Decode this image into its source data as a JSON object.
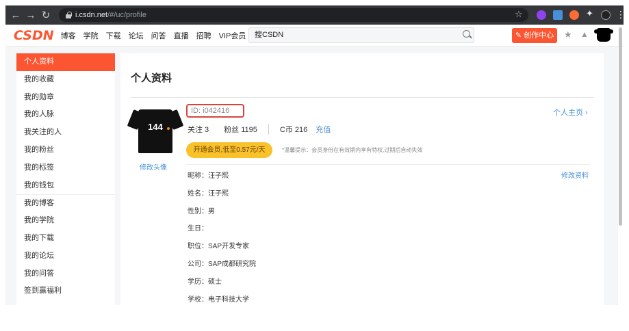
{
  "browser": {
    "url_host": "i.csdn.net",
    "url_path": "/#/uc/profile"
  },
  "header": {
    "logo": "CSDN",
    "nav": [
      "博客",
      "学院",
      "下载",
      "论坛",
      "问答",
      "直播",
      "招聘",
      "VIP会员"
    ],
    "search_placeholder": "搜CSDN",
    "create_button": "创作中心"
  },
  "sidebar": {
    "items": [
      {
        "label": "个人资料",
        "active": true
      },
      {
        "label": "我的收藏"
      },
      {
        "label": "我的勋章"
      },
      {
        "label": "我的人脉"
      },
      {
        "label": "我关注的人"
      },
      {
        "label": "我的粉丝"
      },
      {
        "label": "我的标签"
      },
      {
        "label": "我的钱包"
      },
      {
        "label": "我的博客"
      },
      {
        "label": "我的学院"
      },
      {
        "label": "我的下载"
      },
      {
        "label": "我的论坛"
      },
      {
        "label": "我的问答"
      },
      {
        "label": "签到赢福利"
      }
    ]
  },
  "profile": {
    "title": "个人资料",
    "id_text": "ID: i042416",
    "home_link": "个人主页",
    "edit_avatar": "修改头像",
    "avatar_number": "144",
    "stats": {
      "following": "关注 3",
      "followers": "粉丝 1195",
      "credit": "C币 216",
      "credit_link": "充值"
    },
    "vip_button": "开通会员,低至0.57元/天",
    "vip_note": "*温馨提示：会员身份在有效期内享有特权,过期后自动失效",
    "edit_info": "修改资料",
    "fields": [
      "昵称：汪子熙",
      "姓名：汪子熙",
      "性别：男",
      "生日：",
      "职位：SAP开发专家",
      "公司：SAP成都研究院",
      "学历：硕士",
      "学校：电子科技大学"
    ]
  },
  "colors": {
    "brand": "#fc5531",
    "link": "#4a90d9",
    "vip": "#f8c22b",
    "highlight_box": "#d6453b"
  }
}
